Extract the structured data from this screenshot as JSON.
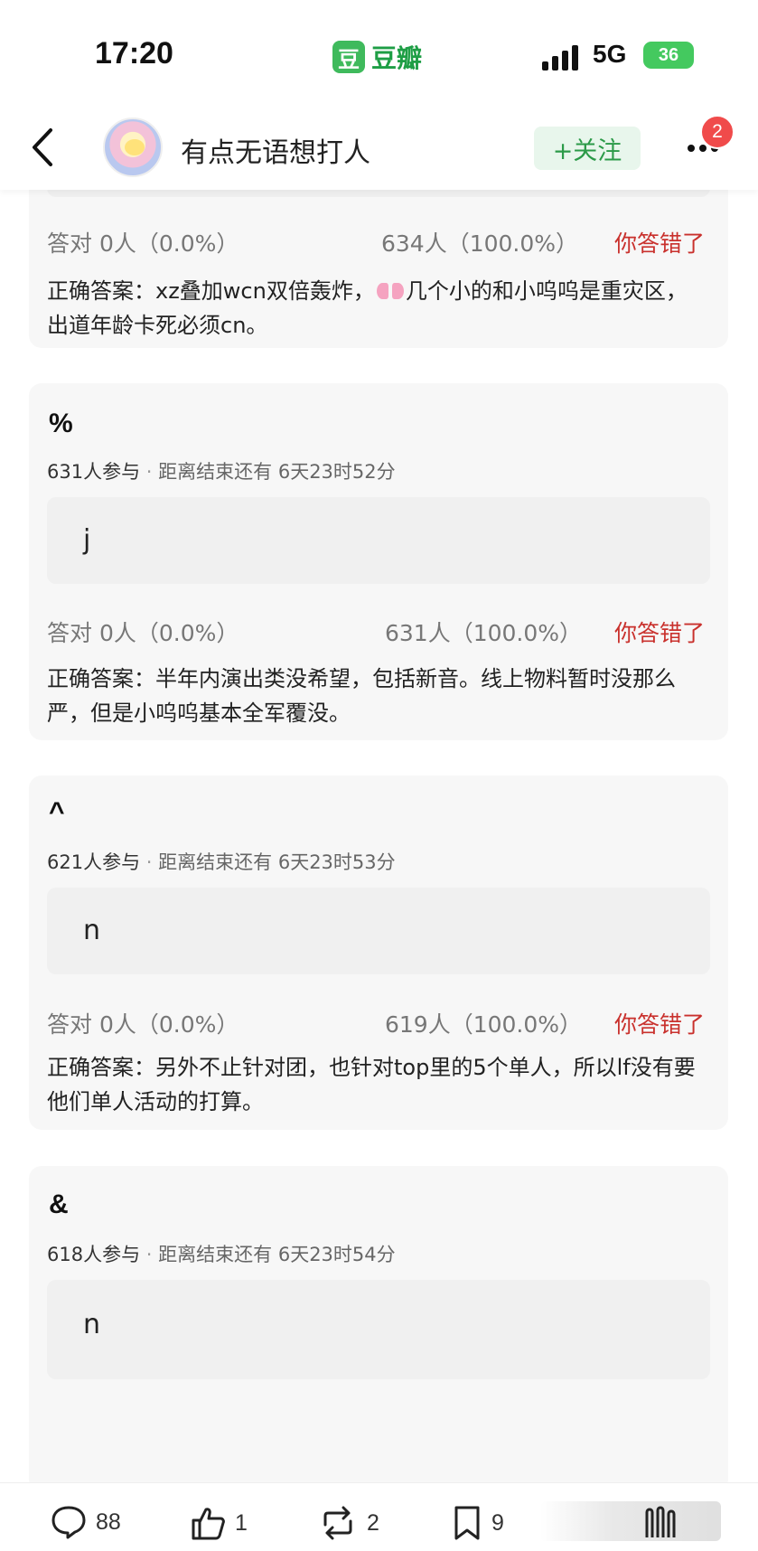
{
  "status_bar": {
    "time": "17:20",
    "app_logo": "豆",
    "app_name": "豆瓣",
    "network": "5G",
    "battery": "36"
  },
  "nav": {
    "title": "有点无语想打人",
    "follow_label": "+关注",
    "notification_count": "2"
  },
  "cards": [
    {
      "correct_stats": "答对  0人（0.0%）",
      "wrong_stats": "634人（100.0%）",
      "verdict": "你答错了",
      "answer_part1": "正确答案：xz叠加wcn双倍轰炸，",
      "answer_part2": "几个小的和小呜呜是重灾区，出道年龄卡死必须cn。"
    },
    {
      "title": "%",
      "participants": "631人参与",
      "separator": "·",
      "remaining": "距离结束还有 6天23时52分",
      "option": "j",
      "correct_stats": "答对  0人（0.0%）",
      "wrong_stats": "631人（100.0%）",
      "verdict": "你答错了",
      "answer": "正确答案：半年内演出类没希望，包括新音。线上物料暂时没那么严，但是小呜呜基本全军覆没。"
    },
    {
      "title": "^",
      "participants": "621人参与",
      "separator": "·",
      "remaining": "距离结束还有 6天23时53分",
      "option": "n",
      "correct_stats": "答对  0人（0.0%）",
      "wrong_stats": "619人（100.0%）",
      "verdict": "你答错了",
      "answer": "正确答案：另外不止针对团，也针对top里的5个单人，所以lf没有要他们单人活动的打算。"
    },
    {
      "title": "&",
      "participants": "618人参与",
      "separator": "·",
      "remaining": "距离结束还有 6天23时54分",
      "option": "n"
    }
  ],
  "bottom_bar": {
    "comments": "88",
    "likes": "1",
    "reposts": "2",
    "collects": "9"
  },
  "colors": {
    "brand_green": "#3fba5c",
    "wrong_red": "#c9312d",
    "badge_red": "#f04b4b",
    "card_bg": "#f7f7f7"
  }
}
